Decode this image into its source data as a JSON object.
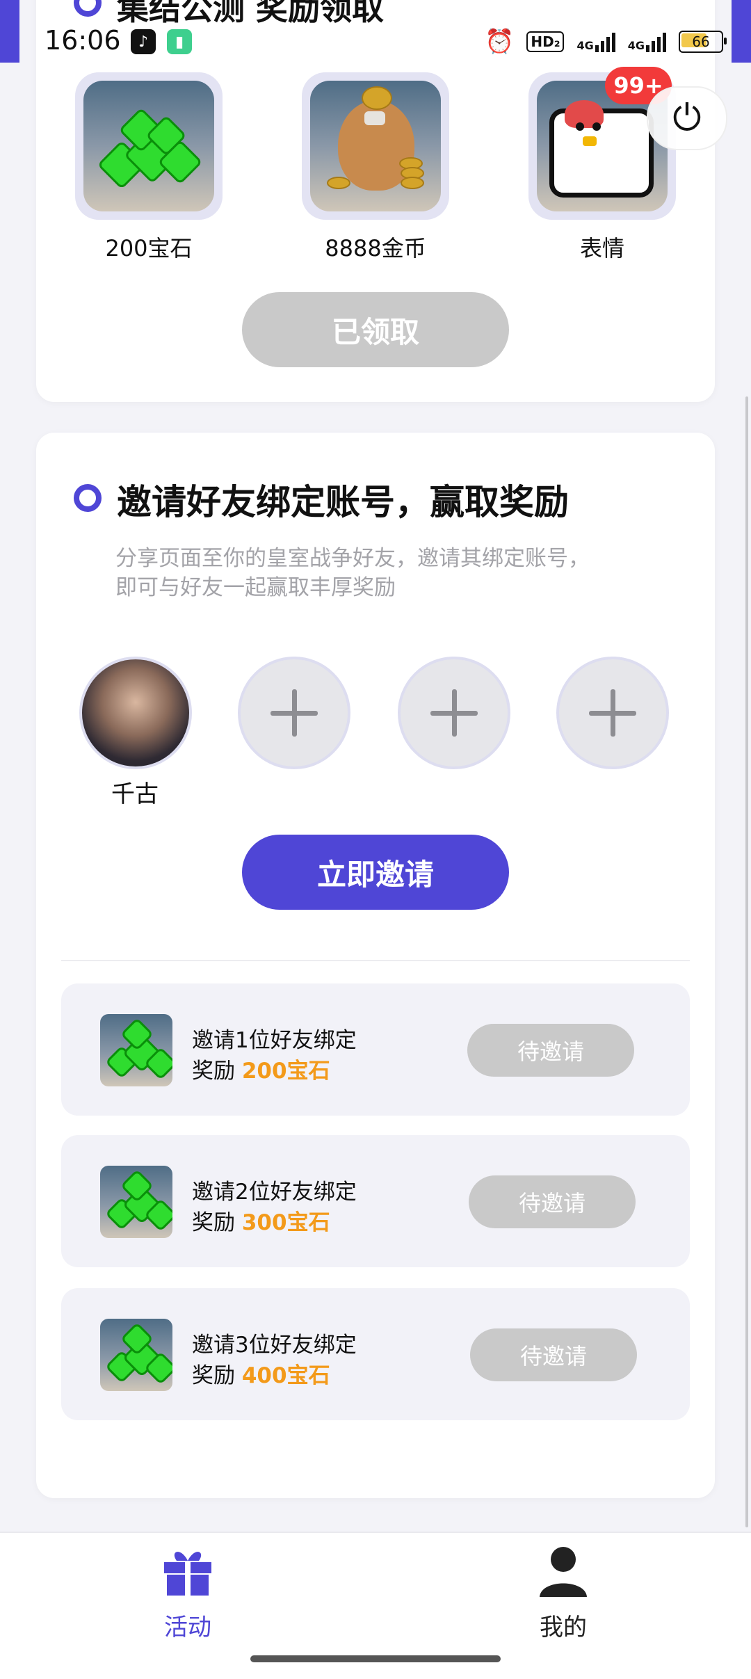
{
  "status_bar": {
    "time": "16:06",
    "network_badge": "HD₂",
    "net_label_1": "4G",
    "net_label_2": "4G",
    "battery": "66"
  },
  "top_card": {
    "title": "集结公测 奖励领取",
    "rewards": [
      {
        "label": "200宝石",
        "icon": "gems-icon"
      },
      {
        "label": "8888金币",
        "icon": "coin-bag-icon"
      },
      {
        "label": "表情",
        "icon": "emote-chicken-icon"
      }
    ],
    "badge": "99+",
    "power_icon": "power-icon",
    "claim_button": "已领取"
  },
  "invite_card": {
    "title": "邀请好友绑定账号，赢取奖励",
    "description_lines": [
      "分享页面至你的皇室战争好友，邀请其绑定账号，",
      "即可与好友一起赢取丰厚奖励"
    ],
    "friends": [
      {
        "name": "千古",
        "filled": true
      }
    ],
    "empty_slots": 3,
    "invite_button": "立即邀请",
    "tasks": [
      {
        "line1": "邀请1位好友绑定",
        "reward_prefix": "奖励 ",
        "reward_amount": "200宝石",
        "button": "待邀请"
      },
      {
        "line1": "邀请2位好友绑定",
        "reward_prefix": "奖励 ",
        "reward_amount": "300宝石",
        "button": "待邀请"
      },
      {
        "line1": "邀请3位好友绑定",
        "reward_prefix": "奖励 ",
        "reward_amount": "400宝石",
        "button": "待邀请"
      }
    ]
  },
  "bottom_nav": {
    "items": [
      {
        "label": "活动",
        "icon": "gift-icon",
        "active": true
      },
      {
        "label": "我的",
        "icon": "user-icon",
        "active": false
      }
    ]
  },
  "colors": {
    "accent": "#4f46d6",
    "reward_amount": "#f39a1a",
    "disabled_button": "#c9c9c9",
    "badge": "#f23a3a"
  }
}
